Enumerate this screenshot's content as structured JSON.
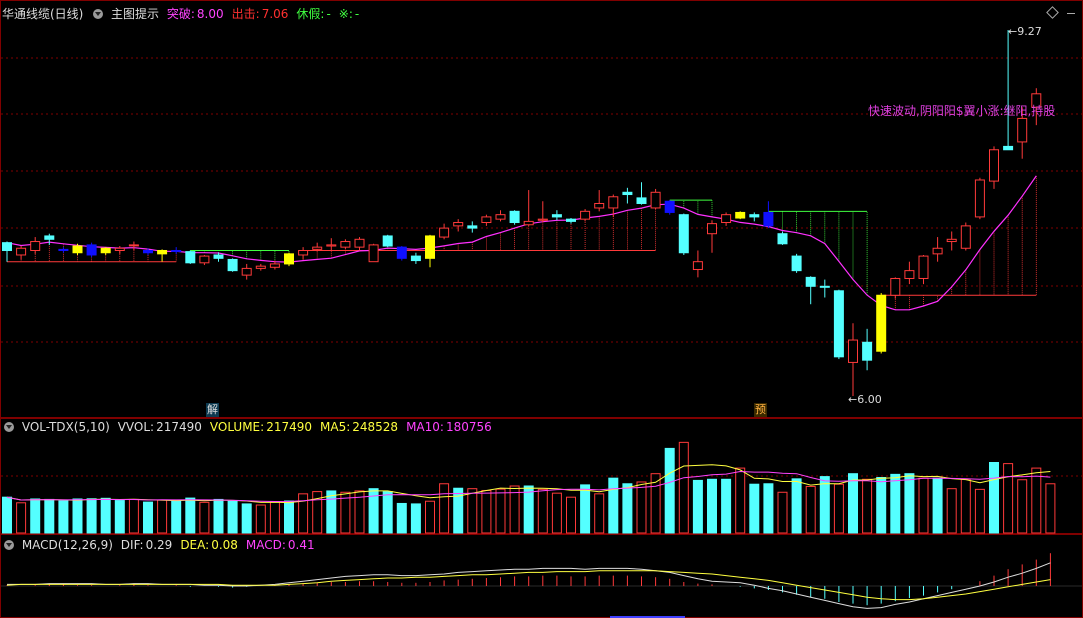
{
  "main_panel": {
    "stock_name": "华通线缆(日线)",
    "indicator_name": "主图提示",
    "items": [
      {
        "label": "突破:",
        "value": "8.00",
        "color": "#ff44ff"
      },
      {
        "label": "出击:",
        "value": "7.06",
        "color": "#ff3030"
      },
      {
        "label": "休假:",
        "value": "-",
        "color": "#40ff40"
      },
      {
        "label": "※:",
        "value": "-",
        "color": "#40ff40"
      }
    ],
    "high_label": "9.27",
    "low_label": "6.00",
    "annotation": "快速波动,阴阳阳$翼小涨:继阳,持股",
    "tag_jie": "解",
    "tag_yu": "预",
    "colors": {
      "up": "#ff3a3a",
      "down": "#54ffff",
      "yellow": "#ffff00",
      "blue": "#1010ff",
      "ma": "#ff30ff",
      "green": "#40ff40",
      "grid": "#800000"
    }
  },
  "vol_panel": {
    "title": "VOL-TDX(5,10)",
    "items": [
      {
        "label": "VVOL:",
        "value": "217490",
        "color": "#dddddd"
      },
      {
        "label": "VOLUME:",
        "value": "217490",
        "color": "#ffff40"
      },
      {
        "label": "MA5:",
        "value": "248528",
        "color": "#ffff40"
      },
      {
        "label": "MA10:",
        "value": "180756",
        "color": "#ff44ff"
      }
    ]
  },
  "macd_panel": {
    "title": "MACD(12,26,9)",
    "items": [
      {
        "label": "DIF:",
        "value": "0.29",
        "color": "#dddddd"
      },
      {
        "label": "DEA:",
        "value": "0.08",
        "color": "#ffff40"
      },
      {
        "label": "MACD:",
        "value": "0.41",
        "color": "#ff44ff"
      }
    ]
  },
  "chart_data": {
    "type": "candlestick",
    "price_range": [
      6.0,
      9.27
    ],
    "candles": [
      {
        "o": 7.3,
        "c": 7.37,
        "h": 7.38,
        "l": 7.2,
        "k": "down"
      },
      {
        "o": 7.26,
        "c": 7.32,
        "h": 7.34,
        "l": 7.22,
        "k": "up"
      },
      {
        "o": 7.3,
        "c": 7.38,
        "h": 7.42,
        "l": 7.27,
        "k": "up"
      },
      {
        "o": 7.4,
        "c": 7.43,
        "h": 7.45,
        "l": 7.35,
        "k": "down"
      },
      {
        "o": 7.31,
        "c": 7.3,
        "h": 7.33,
        "l": 7.28,
        "k": "blue"
      },
      {
        "o": 7.34,
        "c": 7.28,
        "h": 7.36,
        "l": 7.26,
        "k": "yellow"
      },
      {
        "o": 7.35,
        "c": 7.26,
        "h": 7.37,
        "l": 7.24,
        "k": "blue"
      },
      {
        "o": 7.32,
        "c": 7.28,
        "h": 7.33,
        "l": 7.26,
        "k": "yellow"
      },
      {
        "o": 7.3,
        "c": 7.32,
        "h": 7.34,
        "l": 7.27,
        "k": "up"
      },
      {
        "o": 7.35,
        "c": 7.35,
        "h": 7.38,
        "l": 7.3,
        "k": "up"
      },
      {
        "o": 7.3,
        "c": 7.28,
        "h": 7.32,
        "l": 7.26,
        "k": "blue"
      },
      {
        "o": 7.3,
        "c": 7.27,
        "h": 7.31,
        "l": 7.2,
        "k": "yellow"
      },
      {
        "o": 7.3,
        "c": 7.3,
        "h": 7.33,
        "l": 7.27,
        "k": "blue"
      },
      {
        "o": 7.29,
        "c": 7.19,
        "h": 7.3,
        "l": 7.18,
        "k": "down"
      },
      {
        "o": 7.19,
        "c": 7.25,
        "h": 7.26,
        "l": 7.17,
        "k": "up"
      },
      {
        "o": 7.23,
        "c": 7.26,
        "h": 7.28,
        "l": 7.2,
        "k": "down"
      },
      {
        "o": 7.22,
        "c": 7.12,
        "h": 7.23,
        "l": 7.11,
        "k": "down"
      },
      {
        "o": 7.08,
        "c": 7.14,
        "h": 7.18,
        "l": 7.04,
        "k": "up"
      },
      {
        "o": 7.14,
        "c": 7.16,
        "h": 7.18,
        "l": 7.12,
        "k": "up"
      },
      {
        "o": 7.15,
        "c": 7.18,
        "h": 7.21,
        "l": 7.13,
        "k": "up"
      },
      {
        "o": 7.18,
        "c": 7.27,
        "h": 7.28,
        "l": 7.16,
        "k": "yellow"
      },
      {
        "o": 7.26,
        "c": 7.3,
        "h": 7.33,
        "l": 7.22,
        "k": "up"
      },
      {
        "o": 7.31,
        "c": 7.33,
        "h": 7.37,
        "l": 7.29,
        "k": "up"
      },
      {
        "o": 7.34,
        "c": 7.35,
        "h": 7.41,
        "l": 7.3,
        "k": "up"
      },
      {
        "o": 7.33,
        "c": 7.38,
        "h": 7.4,
        "l": 7.31,
        "k": "up"
      },
      {
        "o": 7.33,
        "c": 7.4,
        "h": 7.42,
        "l": 7.3,
        "k": "up"
      },
      {
        "o": 7.35,
        "c": 7.2,
        "h": 7.36,
        "l": 7.2,
        "k": "up"
      },
      {
        "o": 7.43,
        "c": 7.34,
        "h": 7.44,
        "l": 7.33,
        "k": "down"
      },
      {
        "o": 7.33,
        "c": 7.23,
        "h": 7.34,
        "l": 7.21,
        "k": "blue"
      },
      {
        "o": 7.21,
        "c": 7.25,
        "h": 7.28,
        "l": 7.18,
        "k": "down"
      },
      {
        "o": 7.23,
        "c": 7.43,
        "h": 7.44,
        "l": 7.15,
        "k": "yellow"
      },
      {
        "o": 7.42,
        "c": 7.5,
        "h": 7.54,
        "l": 7.4,
        "k": "up"
      },
      {
        "o": 7.52,
        "c": 7.55,
        "h": 7.58,
        "l": 7.47,
        "k": "up"
      },
      {
        "o": 7.52,
        "c": 7.5,
        "h": 7.56,
        "l": 7.46,
        "k": "down"
      },
      {
        "o": 7.55,
        "c": 7.6,
        "h": 7.62,
        "l": 7.52,
        "k": "up"
      },
      {
        "o": 7.58,
        "c": 7.62,
        "h": 7.66,
        "l": 7.56,
        "k": "up"
      },
      {
        "o": 7.65,
        "c": 7.55,
        "h": 7.66,
        "l": 7.53,
        "k": "down"
      },
      {
        "o": 7.53,
        "c": 7.56,
        "h": 7.84,
        "l": 7.52,
        "k": "up"
      },
      {
        "o": 7.57,
        "c": 7.58,
        "h": 7.74,
        "l": 7.55,
        "k": "up"
      },
      {
        "o": 7.62,
        "c": 7.6,
        "h": 7.66,
        "l": 7.57,
        "k": "down"
      },
      {
        "o": 7.58,
        "c": 7.56,
        "h": 7.59,
        "l": 7.54,
        "k": "down"
      },
      {
        "o": 7.58,
        "c": 7.65,
        "h": 7.67,
        "l": 7.56,
        "k": "up"
      },
      {
        "o": 7.68,
        "c": 7.72,
        "h": 7.84,
        "l": 7.65,
        "k": "up"
      },
      {
        "o": 7.68,
        "c": 7.78,
        "h": 7.8,
        "l": 7.6,
        "k": "up"
      },
      {
        "o": 7.8,
        "c": 7.82,
        "h": 7.86,
        "l": 7.72,
        "k": "down"
      },
      {
        "o": 7.77,
        "c": 7.72,
        "h": 7.91,
        "l": 7.71,
        "k": "down"
      },
      {
        "o": 7.68,
        "c": 7.82,
        "h": 7.85,
        "l": 7.67,
        "k": "up"
      },
      {
        "o": 7.74,
        "c": 7.64,
        "h": 7.75,
        "l": 7.62,
        "k": "blue"
      },
      {
        "o": 7.62,
        "c": 7.28,
        "h": 7.63,
        "l": 7.26,
        "k": "down"
      },
      {
        "o": 7.13,
        "c": 7.2,
        "h": 7.3,
        "l": 7.06,
        "k": "up"
      },
      {
        "o": 7.45,
        "c": 7.54,
        "h": 7.57,
        "l": 7.28,
        "k": "up"
      },
      {
        "o": 7.55,
        "c": 7.62,
        "h": 7.64,
        "l": 7.52,
        "k": "up"
      },
      {
        "o": 7.64,
        "c": 7.59,
        "h": 7.65,
        "l": 7.58,
        "k": "yellow"
      },
      {
        "o": 7.62,
        "c": 7.6,
        "h": 7.64,
        "l": 7.56,
        "k": "down"
      },
      {
        "o": 7.52,
        "c": 7.64,
        "h": 7.74,
        "l": 7.5,
        "k": "blue"
      },
      {
        "o": 7.45,
        "c": 7.36,
        "h": 7.47,
        "l": 7.35,
        "k": "down"
      },
      {
        "o": 7.25,
        "c": 7.12,
        "h": 7.27,
        "l": 7.1,
        "k": "down"
      },
      {
        "o": 7.06,
        "c": 6.98,
        "h": 7.07,
        "l": 6.82,
        "k": "down"
      },
      {
        "o": 6.98,
        "c": 6.98,
        "h": 7.04,
        "l": 6.88,
        "k": "down"
      },
      {
        "o": 6.94,
        "c": 6.35,
        "h": 6.95,
        "l": 6.33,
        "k": "down"
      },
      {
        "o": 6.5,
        "c": 6.3,
        "h": 6.65,
        "l": 6.0,
        "k": "up"
      },
      {
        "o": 6.32,
        "c": 6.48,
        "h": 6.6,
        "l": 6.23,
        "k": "down"
      },
      {
        "o": 6.4,
        "c": 6.9,
        "h": 6.92,
        "l": 6.38,
        "k": "yellow"
      },
      {
        "o": 6.9,
        "c": 7.05,
        "h": 7.06,
        "l": 6.87,
        "k": "up"
      },
      {
        "o": 7.05,
        "c": 7.12,
        "h": 7.2,
        "l": 7.0,
        "k": "up"
      },
      {
        "o": 7.05,
        "c": 7.25,
        "h": 7.26,
        "l": 7.0,
        "k": "up"
      },
      {
        "o": 7.27,
        "c": 7.32,
        "h": 7.42,
        "l": 7.2,
        "k": "up"
      },
      {
        "o": 7.4,
        "c": 7.38,
        "h": 7.47,
        "l": 7.3,
        "k": "up"
      },
      {
        "o": 7.32,
        "c": 7.52,
        "h": 7.55,
        "l": 7.3,
        "k": "up"
      },
      {
        "o": 7.6,
        "c": 7.93,
        "h": 7.95,
        "l": 7.58,
        "k": "up"
      },
      {
        "o": 7.92,
        "c": 8.2,
        "h": 8.23,
        "l": 7.85,
        "k": "up"
      },
      {
        "o": 8.23,
        "c": 8.2,
        "h": 9.27,
        "l": 8.21,
        "k": "down"
      },
      {
        "o": 8.27,
        "c": 8.48,
        "h": 8.58,
        "l": 8.12,
        "k": "up"
      },
      {
        "o": 8.58,
        "c": 8.7,
        "h": 8.75,
        "l": 8.42,
        "k": "up"
      }
    ],
    "volume": [
      {
        "v": 160,
        "k": "down"
      },
      {
        "v": 135,
        "k": "up"
      },
      {
        "v": 152,
        "k": "down"
      },
      {
        "v": 150,
        "k": "down"
      },
      {
        "v": 143,
        "k": "down"
      },
      {
        "v": 152,
        "k": "down"
      },
      {
        "v": 153,
        "k": "down"
      },
      {
        "v": 155,
        "k": "down"
      },
      {
        "v": 145,
        "k": "down"
      },
      {
        "v": 150,
        "k": "up"
      },
      {
        "v": 138,
        "k": "down"
      },
      {
        "v": 147,
        "k": "up"
      },
      {
        "v": 144,
        "k": "down"
      },
      {
        "v": 156,
        "k": "down"
      },
      {
        "v": 137,
        "k": "up"
      },
      {
        "v": 150,
        "k": "down"
      },
      {
        "v": 142,
        "k": "down"
      },
      {
        "v": 130,
        "k": "down"
      },
      {
        "v": 125,
        "k": "up"
      },
      {
        "v": 140,
        "k": "up"
      },
      {
        "v": 143,
        "k": "down"
      },
      {
        "v": 175,
        "k": "up"
      },
      {
        "v": 185,
        "k": "up"
      },
      {
        "v": 188,
        "k": "down"
      },
      {
        "v": 182,
        "k": "up"
      },
      {
        "v": 188,
        "k": "up"
      },
      {
        "v": 198,
        "k": "down"
      },
      {
        "v": 185,
        "k": "down"
      },
      {
        "v": 132,
        "k": "down"
      },
      {
        "v": 130,
        "k": "down"
      },
      {
        "v": 142,
        "k": "up"
      },
      {
        "v": 220,
        "k": "up"
      },
      {
        "v": 200,
        "k": "down"
      },
      {
        "v": 198,
        "k": "up"
      },
      {
        "v": 190,
        "k": "up"
      },
      {
        "v": 196,
        "k": "up"
      },
      {
        "v": 210,
        "k": "up"
      },
      {
        "v": 210,
        "k": "down"
      },
      {
        "v": 195,
        "k": "up"
      },
      {
        "v": 178,
        "k": "up"
      },
      {
        "v": 160,
        "k": "up"
      },
      {
        "v": 215,
        "k": "down"
      },
      {
        "v": 175,
        "k": "up"
      },
      {
        "v": 245,
        "k": "down"
      },
      {
        "v": 220,
        "k": "down"
      },
      {
        "v": 228,
        "k": "up"
      },
      {
        "v": 265,
        "k": "up"
      },
      {
        "v": 378,
        "k": "down"
      },
      {
        "v": 405,
        "k": "up"
      },
      {
        "v": 235,
        "k": "down"
      },
      {
        "v": 240,
        "k": "down"
      },
      {
        "v": 240,
        "k": "down"
      },
      {
        "v": 290,
        "k": "up"
      },
      {
        "v": 218,
        "k": "down"
      },
      {
        "v": 220,
        "k": "down"
      },
      {
        "v": 182,
        "k": "up"
      },
      {
        "v": 242,
        "k": "down"
      },
      {
        "v": 208,
        "k": "up"
      },
      {
        "v": 252,
        "k": "down"
      },
      {
        "v": 218,
        "k": "up"
      },
      {
        "v": 265,
        "k": "down"
      },
      {
        "v": 240,
        "k": "up"
      },
      {
        "v": 248,
        "k": "down"
      },
      {
        "v": 262,
        "k": "down"
      },
      {
        "v": 265,
        "k": "down"
      },
      {
        "v": 245,
        "k": "up"
      },
      {
        "v": 245,
        "k": "down"
      },
      {
        "v": 198,
        "k": "up"
      },
      {
        "v": 240,
        "k": "up"
      },
      {
        "v": 195,
        "k": "up"
      },
      {
        "v": 315,
        "k": "down"
      },
      {
        "v": 310,
        "k": "up"
      },
      {
        "v": 238,
        "k": "up"
      },
      {
        "v": 290,
        "k": "up"
      },
      {
        "v": 220,
        "k": "up"
      }
    ],
    "macd": [
      0.01,
      0.0,
      0.01,
      0.02,
      0.02,
      0.01,
      0.01,
      0.0,
      0.01,
      0.02,
      0.01,
      0.0,
      0.01,
      -0.01,
      0.0,
      -0.01,
      -0.02,
      -0.01,
      0.0,
      0.01,
      0.02,
      0.03,
      0.04,
      0.05,
      0.05,
      0.06,
      0.06,
      0.05,
      0.04,
      0.04,
      0.05,
      0.07,
      0.08,
      0.09,
      0.1,
      0.11,
      0.12,
      0.12,
      0.13,
      0.13,
      0.12,
      0.12,
      0.13,
      0.13,
      0.13,
      0.12,
      0.11,
      0.09,
      0.05,
      0.03,
      0.02,
      0.0,
      -0.01,
      -0.03,
      -0.05,
      -0.08,
      -0.11,
      -0.14,
      -0.16,
      -0.2,
      -0.22,
      -0.24,
      -0.22,
      -0.19,
      -0.15,
      -0.12,
      -0.08,
      -0.04,
      0.0,
      0.06,
      0.13,
      0.21,
      0.27,
      0.33,
      0.41
    ],
    "dif": [
      0.02,
      0.02,
      0.02,
      0.03,
      0.03,
      0.03,
      0.03,
      0.02,
      0.02,
      0.03,
      0.03,
      0.02,
      0.02,
      0.02,
      0.01,
      0.01,
      0.0,
      0.0,
      0.01,
      0.02,
      0.04,
      0.06,
      0.08,
      0.1,
      0.12,
      0.13,
      0.14,
      0.14,
      0.13,
      0.13,
      0.14,
      0.15,
      0.17,
      0.18,
      0.19,
      0.2,
      0.21,
      0.21,
      0.22,
      0.22,
      0.22,
      0.21,
      0.22,
      0.22,
      0.22,
      0.21,
      0.19,
      0.17,
      0.13,
      0.09,
      0.06,
      0.05,
      0.04,
      0.01,
      -0.03,
      -0.06,
      -0.1,
      -0.14,
      -0.18,
      -0.22,
      -0.26,
      -0.28,
      -0.27,
      -0.23,
      -0.2,
      -0.16,
      -0.12,
      -0.08,
      -0.04,
      0.0,
      0.05,
      0.11,
      0.16,
      0.22,
      0.29
    ],
    "dea": [
      0.01,
      0.02,
      0.02,
      0.02,
      0.02,
      0.02,
      0.02,
      0.02,
      0.02,
      0.02,
      0.02,
      0.02,
      0.02,
      0.02,
      0.02,
      0.02,
      0.01,
      0.01,
      0.01,
      0.01,
      0.02,
      0.03,
      0.04,
      0.06,
      0.07,
      0.08,
      0.09,
      0.1,
      0.1,
      0.11,
      0.11,
      0.12,
      0.13,
      0.14,
      0.14,
      0.15,
      0.16,
      0.17,
      0.17,
      0.18,
      0.18,
      0.18,
      0.19,
      0.19,
      0.19,
      0.19,
      0.19,
      0.18,
      0.17,
      0.16,
      0.15,
      0.13,
      0.11,
      0.09,
      0.07,
      0.04,
      0.01,
      -0.02,
      -0.05,
      -0.08,
      -0.11,
      -0.14,
      -0.16,
      -0.17,
      -0.17,
      -0.16,
      -0.14,
      -0.12,
      -0.1,
      -0.07,
      -0.04,
      -0.01,
      0.02,
      0.05,
      0.08
    ]
  }
}
